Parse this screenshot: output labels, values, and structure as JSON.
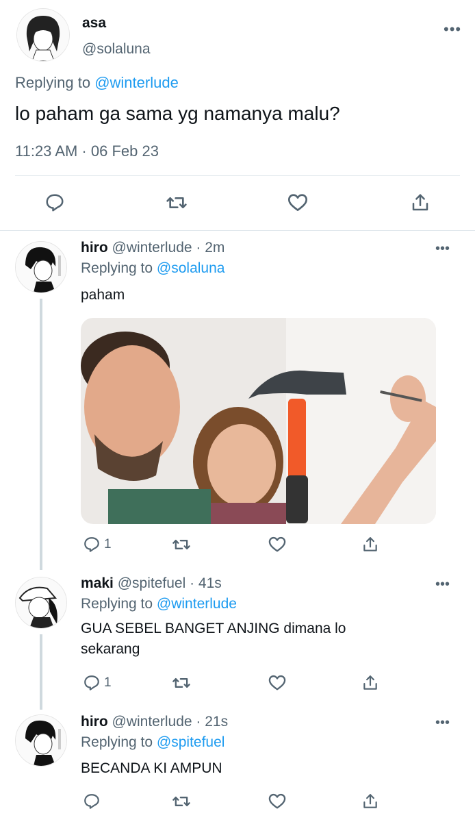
{
  "main_tweet": {
    "name": "asa",
    "handle": "@solaluna",
    "replying_prefix": "Replying to",
    "replying_to": "@winterlude",
    "text": "lo paham ga sama yg namanya malu?",
    "timestamp": "11:23 AM · 06 Feb 23",
    "more": "•••"
  },
  "replies": [
    {
      "name": "hiro",
      "meta": "@winterlude · 2m",
      "replying_prefix": "Replying to",
      "replying_to": "@solaluna",
      "text": "paham",
      "media": "photo",
      "reply_count": "1",
      "more": "•••"
    },
    {
      "name": "maki",
      "meta": "@spitefuel · 41s",
      "replying_prefix": "Replying to",
      "replying_to": "@winterlude",
      "text": "GUA SEBEL BANGET ANJING dimana lo sekarang",
      "reply_count": "1",
      "more": "•••"
    },
    {
      "name": "hiro",
      "meta": "@winterlude · 21s",
      "replying_prefix": "Replying to",
      "replying_to": "@spitefuel",
      "text": "BECANDA KI AMPUN",
      "reply_count": "",
      "more": "•••"
    }
  ],
  "icons": {
    "reply": "reply-icon",
    "retweet": "retweet-icon",
    "like": "like-icon",
    "share": "share-icon"
  },
  "colors": {
    "link": "#1d9bf0",
    "secondary": "#536471",
    "divider": "#e1e8ed"
  }
}
